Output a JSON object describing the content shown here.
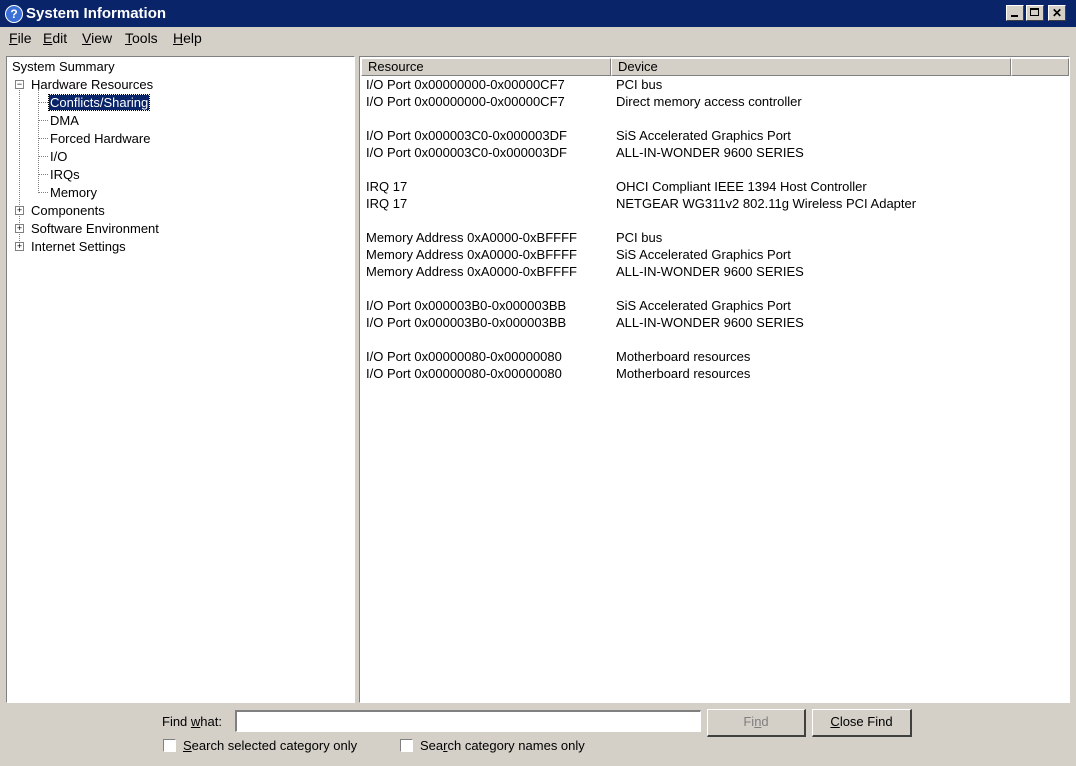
{
  "window": {
    "title": "System Information",
    "icon": "help-question-icon"
  },
  "menu": [
    {
      "label": "File",
      "u": "F",
      "rest": "ile"
    },
    {
      "label": "Edit",
      "u": "E",
      "rest": "dit"
    },
    {
      "label": "View",
      "u": "V",
      "rest": "iew"
    },
    {
      "label": "Tools",
      "u": "T",
      "rest": "ools"
    },
    {
      "label": "Help",
      "u": "H",
      "rest": "elp"
    }
  ],
  "tree": {
    "root": "System Summary",
    "hardware": "Hardware Resources",
    "hardware_children": [
      "Conflicts/Sharing",
      "DMA",
      "Forced Hardware",
      "I/O",
      "IRQs",
      "Memory"
    ],
    "selected": "Conflicts/Sharing",
    "components": "Components",
    "software": "Software Environment",
    "internet": "Internet Settings"
  },
  "list": {
    "columns": [
      "Resource",
      "Device"
    ],
    "groups": [
      [
        {
          "resource": "I/O Port 0x00000000-0x00000CF7",
          "device": "PCI bus"
        },
        {
          "resource": "I/O Port 0x00000000-0x00000CF7",
          "device": "Direct memory access controller"
        }
      ],
      [
        {
          "resource": "I/O Port 0x000003C0-0x000003DF",
          "device": "SiS Accelerated Graphics Port"
        },
        {
          "resource": "I/O Port 0x000003C0-0x000003DF",
          "device": "ALL-IN-WONDER 9600 SERIES"
        }
      ],
      [
        {
          "resource": "IRQ 17",
          "device": "OHCI Compliant IEEE 1394 Host Controller"
        },
        {
          "resource": "IRQ 17",
          "device": "NETGEAR WG311v2 802.11g Wireless PCI Adapter"
        }
      ],
      [
        {
          "resource": "Memory Address 0xA0000-0xBFFFF",
          "device": "PCI bus"
        },
        {
          "resource": "Memory Address 0xA0000-0xBFFFF",
          "device": "SiS Accelerated Graphics Port"
        },
        {
          "resource": "Memory Address 0xA0000-0xBFFFF",
          "device": "ALL-IN-WONDER 9600 SERIES"
        }
      ],
      [
        {
          "resource": "I/O Port 0x000003B0-0x000003BB",
          "device": "SiS Accelerated Graphics Port"
        },
        {
          "resource": "I/O Port 0x000003B0-0x000003BB",
          "device": "ALL-IN-WONDER 9600 SERIES"
        }
      ],
      [
        {
          "resource": "I/O Port 0x00000080-0x00000080",
          "device": "Motherboard resources"
        },
        {
          "resource": "I/O Port 0x00000080-0x00000080",
          "device": "Motherboard resources"
        }
      ]
    ]
  },
  "find": {
    "label_pre": "Find ",
    "label_u": "w",
    "label_post": "hat:",
    "value": "",
    "find_button_pre": "Fi",
    "find_button_u": "n",
    "find_button_post": "d",
    "close_button_u": "C",
    "close_button_post": "lose Find",
    "chk_selected_pre": "",
    "chk_selected_u": "S",
    "chk_selected_post": "earch selected category only",
    "chk_names_pre": "Sea",
    "chk_names_u": "r",
    "chk_names_post": "ch category names only"
  }
}
